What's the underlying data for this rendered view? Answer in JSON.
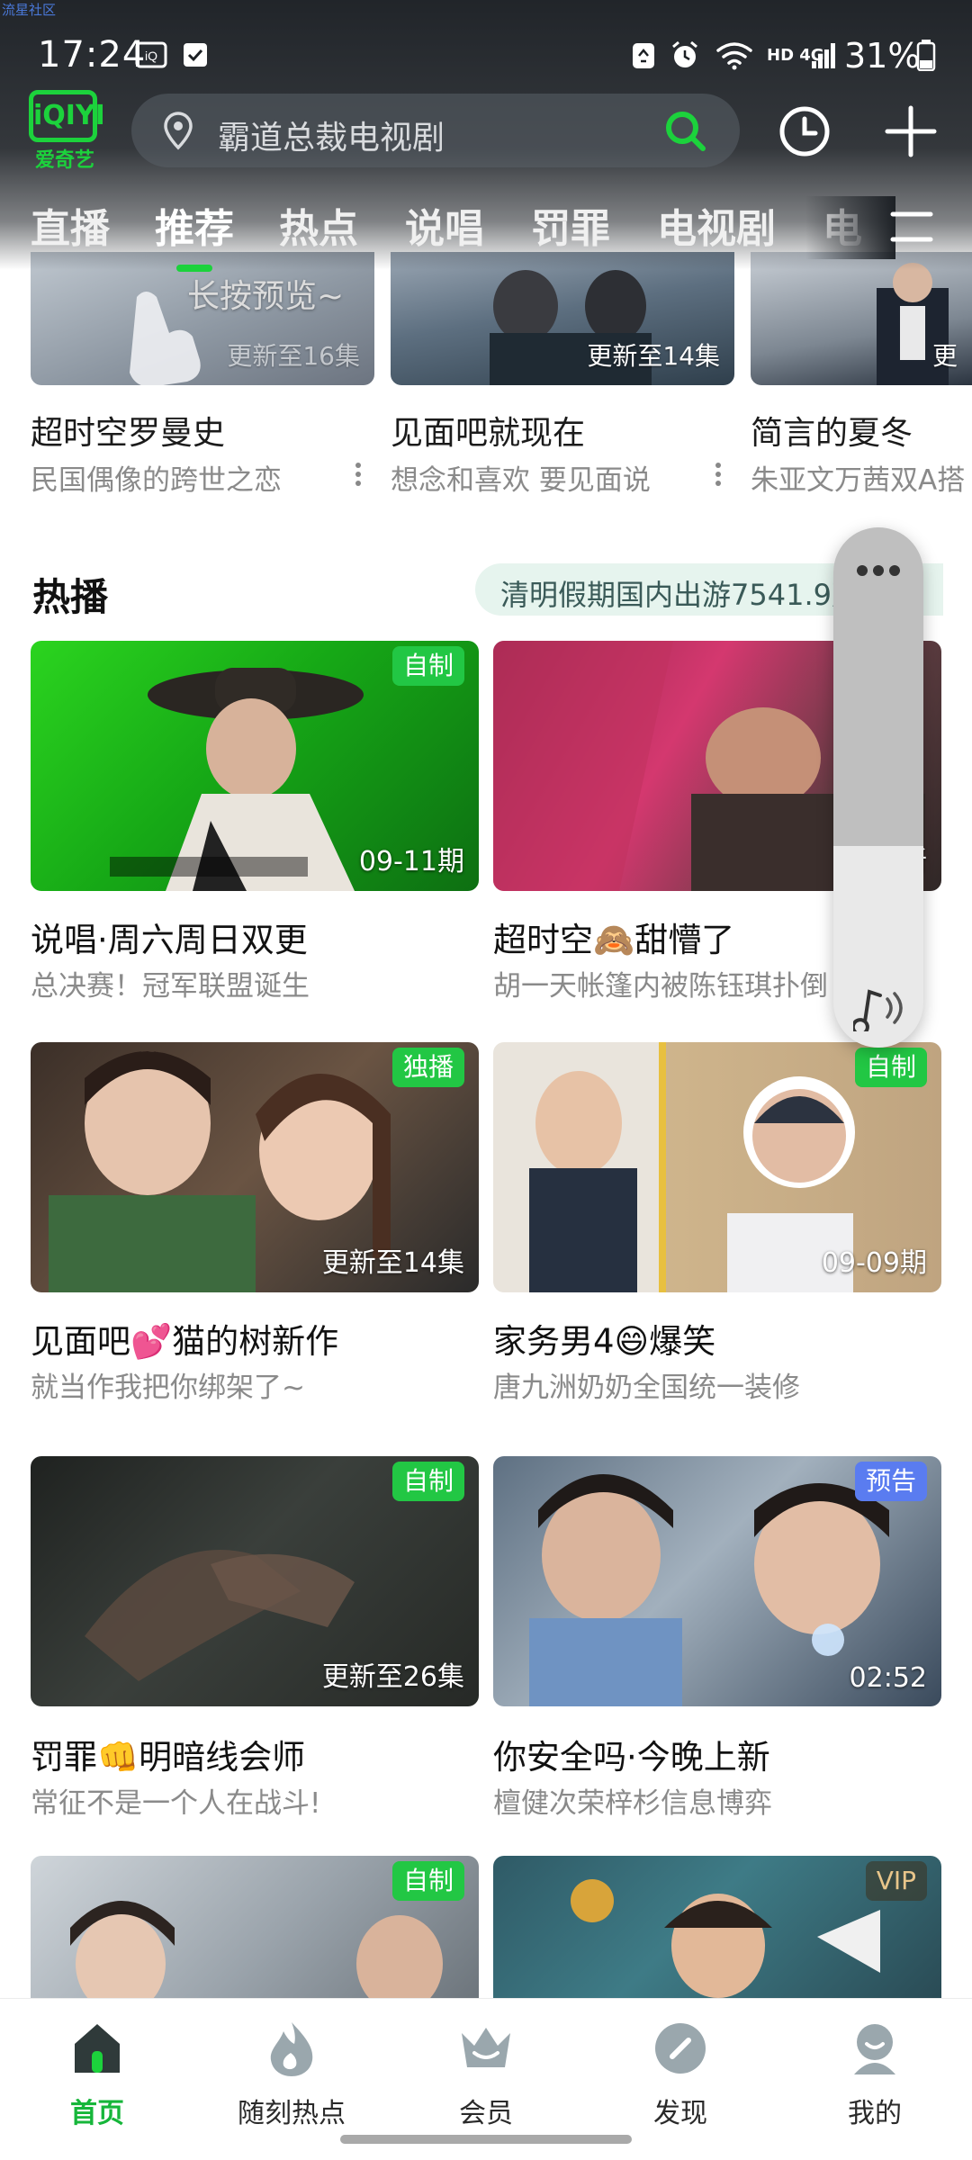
{
  "watermark": "流星社区",
  "status": {
    "time": "17:24",
    "battery": "31%",
    "network": "HD 4G"
  },
  "app": {
    "logo_text": "iQIYI",
    "logo_sub": "爱奇艺"
  },
  "search": {
    "placeholder": "霸道总裁电视剧"
  },
  "tabs": [
    "直播",
    "推荐",
    "热点",
    "说唱",
    "罚罪",
    "电视剧",
    "电"
  ],
  "active_tab": "推荐",
  "preview_hint": "长按预览~",
  "carousel": [
    {
      "title": "超时空罗曼史",
      "subtitle": "民国偶像的跨世之恋",
      "badge": "更新至16集"
    },
    {
      "title": "见面吧就现在",
      "subtitle": "想念和喜欢 要见面说",
      "badge": "更新至14集"
    },
    {
      "title": "简言的夏冬",
      "subtitle": "朱亚文万茜双A搭",
      "badge": "更"
    }
  ],
  "hot": {
    "title": "热播",
    "news": "清明假期国内出游7541.9万",
    "cards": [
      {
        "title": "说唱·周六周日双更",
        "subtitle": "总决赛！冠军联盟诞生",
        "tag": "自制",
        "meta": "09-11期"
      },
      {
        "title": "超时空🙈甜懵了",
        "subtitle": "胡一天帐篷内被陈钰琪扑倒",
        "tag": "",
        "meta": "更新"
      },
      {
        "title": "见面吧💕猫的树新作",
        "subtitle": "就当作我把你绑架了~",
        "tag": "独播",
        "meta": "更新至14集"
      },
      {
        "title": "家务男4😄爆笑",
        "subtitle": "唐九洲奶奶全国统一装修",
        "tag": "自制",
        "meta": "09-09期"
      },
      {
        "title": "罚罪👊明暗线会师",
        "subtitle": "常征不是一个人在战斗!",
        "tag": "自制",
        "meta": "更新至26集"
      },
      {
        "title": "你安全吗·今晚上新",
        "subtitle": "檀健次荣梓杉信息博弈",
        "tag": "预告",
        "meta": "02:52"
      },
      {
        "title": "",
        "subtitle": "",
        "tag": "自制",
        "meta": ""
      },
      {
        "title": "",
        "subtitle": "",
        "tag": "VIP",
        "meta": ""
      }
    ]
  },
  "bottom_nav": [
    "首页",
    "随刻热点",
    "会员",
    "发现",
    "我的"
  ],
  "colors": {
    "accent": "#1cd23c",
    "nav_active": "#16b63a",
    "tag_green": "#22c744",
    "tag_blue": "#5a7cf0",
    "tag_vip": "#e8c58a"
  }
}
